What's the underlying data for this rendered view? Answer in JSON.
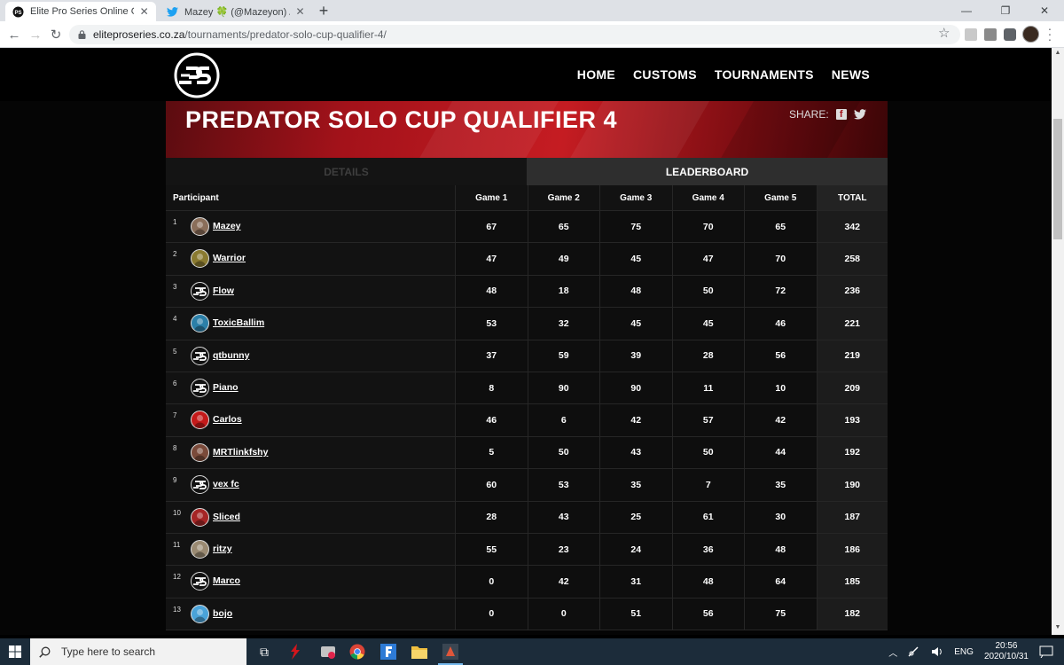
{
  "browser": {
    "tabs": [
      {
        "title": "Elite Pro Series Online Gaming To",
        "active": true
      },
      {
        "title": "Mazey 🍀 (@Mazeyon) / Twitter",
        "active": false
      }
    ],
    "new_tab": "+",
    "url_host": "eliteproseries.co.za",
    "url_path": "/tournaments/predator-solo-cup-qualifier-4/"
  },
  "site": {
    "nav": [
      "HOME",
      "CUSTOMS",
      "TOURNAMENTS",
      "NEWS"
    ],
    "title": "PREDATOR SOLO CUP QUALIFIER 4",
    "share_label": "SHARE:",
    "tabs": {
      "details": "DETAILS",
      "leaderboard": "LEADERBOARD"
    },
    "columns": [
      "Participant",
      "Game 1",
      "Game 2",
      "Game 3",
      "Game 4",
      "Game 5",
      "TOTAL"
    ],
    "rows": [
      {
        "rank": "1",
        "name": "Mazey",
        "avatar": "photo",
        "color": "#8a6e5a",
        "games": [
          "67",
          "65",
          "75",
          "70",
          "65"
        ],
        "total": "342"
      },
      {
        "rank": "2",
        "name": "Warrior",
        "avatar": "photo",
        "color": "#8a7a30",
        "games": [
          "47",
          "49",
          "45",
          "47",
          "70"
        ],
        "total": "258"
      },
      {
        "rank": "3",
        "name": "Flow",
        "avatar": "eps",
        "color": "#111111",
        "games": [
          "48",
          "18",
          "48",
          "50",
          "72"
        ],
        "total": "236"
      },
      {
        "rank": "4",
        "name": "ToxicBallim",
        "avatar": "photo",
        "color": "#2b7fa8",
        "games": [
          "53",
          "32",
          "45",
          "45",
          "46"
        ],
        "total": "221"
      },
      {
        "rank": "5",
        "name": "qtbunny",
        "avatar": "eps",
        "color": "#111111",
        "games": [
          "37",
          "59",
          "39",
          "28",
          "56"
        ],
        "total": "219"
      },
      {
        "rank": "6",
        "name": "Piano",
        "avatar": "eps",
        "color": "#111111",
        "games": [
          "8",
          "90",
          "90",
          "11",
          "10"
        ],
        "total": "209"
      },
      {
        "rank": "7",
        "name": "Carlos",
        "avatar": "photo",
        "color": "#c41a1a",
        "games": [
          "46",
          "6",
          "42",
          "57",
          "42"
        ],
        "total": "193"
      },
      {
        "rank": "8",
        "name": "MRTlinkfshy",
        "avatar": "photo",
        "color": "#7a4a3a",
        "games": [
          "5",
          "50",
          "43",
          "50",
          "44"
        ],
        "total": "192"
      },
      {
        "rank": "9",
        "name": "vex fc",
        "avatar": "eps",
        "color": "#111111",
        "games": [
          "60",
          "53",
          "35",
          "7",
          "35"
        ],
        "total": "190"
      },
      {
        "rank": "10",
        "name": "Sliced",
        "avatar": "photo",
        "color": "#a52525",
        "games": [
          "28",
          "43",
          "25",
          "61",
          "30"
        ],
        "total": "187"
      },
      {
        "rank": "11",
        "name": "ritzy",
        "avatar": "photo",
        "color": "#9a8a72",
        "games": [
          "55",
          "23",
          "24",
          "36",
          "48"
        ],
        "total": "186"
      },
      {
        "rank": "12",
        "name": "Marco",
        "avatar": "eps",
        "color": "#111111",
        "games": [
          "0",
          "42",
          "31",
          "48",
          "64"
        ],
        "total": "185"
      },
      {
        "rank": "13",
        "name": "bojo",
        "avatar": "photo",
        "color": "#4aa3d9",
        "games": [
          "0",
          "0",
          "51",
          "56",
          "75"
        ],
        "total": "182"
      }
    ]
  },
  "taskbar": {
    "search_placeholder": "Type here to search",
    "lang": "ENG",
    "time": "20:56",
    "date": "2020/10/31"
  }
}
